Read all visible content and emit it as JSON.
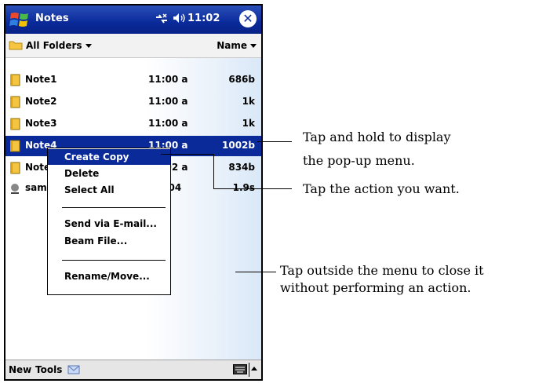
{
  "titlebar": {
    "app_title": "Notes",
    "clock": "11:02",
    "close_label": "✕",
    "icons": [
      "windows-start-icon",
      "connectivity-icon",
      "volume-icon",
      "close-icon"
    ]
  },
  "folderbar": {
    "folder_label": "All Folders",
    "sort_label": "Name"
  },
  "list": {
    "rows": [
      {
        "name": "Note1",
        "time": "11:00 a",
        "size": "686b"
      },
      {
        "name": "Note2",
        "time": "11:00 a",
        "size": "1k"
      },
      {
        "name": "Note3",
        "time": "11:00 a",
        "size": "1k"
      },
      {
        "name": "Note4",
        "time": "11:00 a",
        "size": "1002b",
        "selected": true
      },
      {
        "name": "Note5",
        "time": "11:02 a",
        "size": "834b"
      },
      {
        "name": "sample",
        "time": "3/4/04",
        "size": "1.9s"
      }
    ]
  },
  "popup_menu": {
    "items": [
      {
        "label": "Create Copy",
        "highlight": true
      },
      {
        "label": "Delete"
      },
      {
        "label": "Select All"
      },
      {
        "label": "Send via E-mail..."
      },
      {
        "label": "Beam File..."
      },
      {
        "label": "Rename/Move..."
      }
    ]
  },
  "bottombar": {
    "new_label": "New",
    "tools_label": "Tools"
  },
  "callouts": {
    "c1_line1": "Tap and hold to display",
    "c1_line2": "the pop-up menu.",
    "c2": "Tap the action you want.",
    "c3_line1": "Tap outside the menu to close it",
    "c3_line2": "without performing an action."
  },
  "colors": {
    "titlebar": "#0a2a9a",
    "selection": "#0a2a9a"
  }
}
